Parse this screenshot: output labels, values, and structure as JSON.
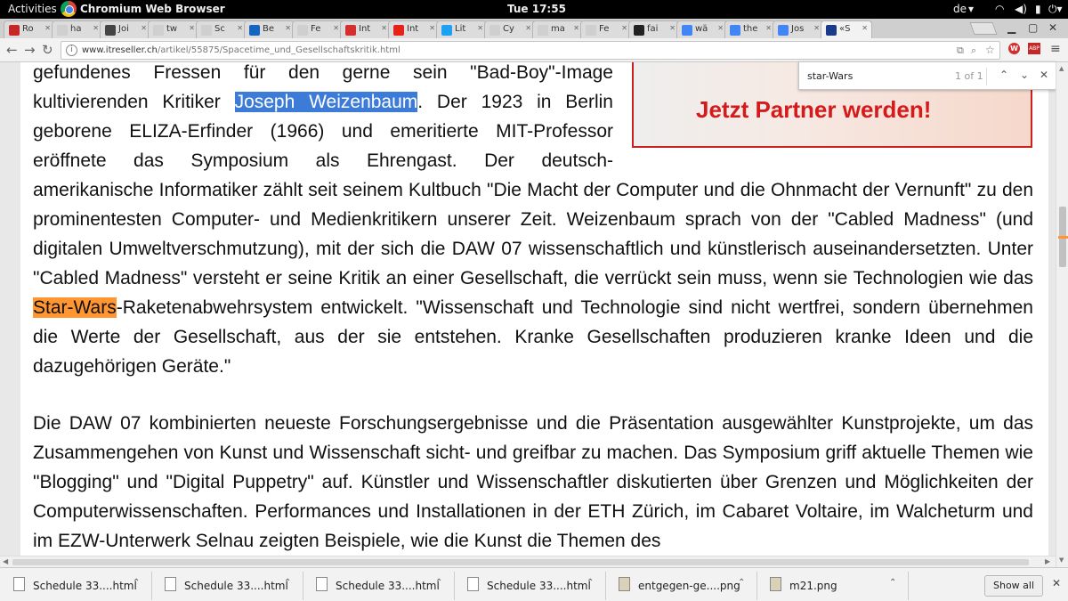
{
  "topbar": {
    "activities": "Activities",
    "app_name": "Chromium Web Browser",
    "clock": "Tue 17:55",
    "keyboard_layout": "de"
  },
  "tabs": [
    {
      "label": "Ro",
      "favicon_color": "#c62828"
    },
    {
      "label": "ha",
      "favicon_color": "#cfcfcf"
    },
    {
      "label": "Joi",
      "favicon_color": "#444444"
    },
    {
      "label": "tw",
      "favicon_color": "#cfcfcf"
    },
    {
      "label": "Sc",
      "favicon_color": "#cfcfcf"
    },
    {
      "label": "Be",
      "favicon_color": "#1565c0"
    },
    {
      "label": "Fe",
      "favicon_color": "#cfcfcf"
    },
    {
      "label": "Int",
      "favicon_color": "#d32f2f"
    },
    {
      "label": "Int",
      "favicon_color": "#e62117"
    },
    {
      "label": "Lit",
      "favicon_color": "#1da1f2"
    },
    {
      "label": "Cy",
      "favicon_color": "#cfcfcf"
    },
    {
      "label": "ma",
      "favicon_color": "#cfcfcf"
    },
    {
      "label": "Fe",
      "favicon_color": "#cfcfcf"
    },
    {
      "label": "fai",
      "favicon_color": "#222222"
    },
    {
      "label": "wä",
      "favicon_color": "#4285f4"
    },
    {
      "label": "the",
      "favicon_color": "#4285f4"
    },
    {
      "label": "Jos",
      "favicon_color": "#4285f4"
    },
    {
      "label": "«S",
      "favicon_color": "#1a3a8a"
    }
  ],
  "address_bar": {
    "host": "www.itreseller.ch",
    "path": "/artikel/55875/Spacetime_und_Gesellschaftskritik.html"
  },
  "find_bar": {
    "query": "star-Wars",
    "match_count": "1 of 1"
  },
  "ad": {
    "text": "Jetzt Partner werden!"
  },
  "article": {
    "p1_narrow": [
      {
        "text": "gefundenes Fressen für den gerne sein \"Bad-Boy\"-Image"
      },
      {
        "pre": "kultivierenden Kritiker ",
        "sel": "Joseph Weizenbaum",
        "post": ". Der 1923 in Berlin"
      },
      {
        "text": "geborene ELIZA-Erfinder (1966) und emeritierte MIT-Professor"
      },
      {
        "text": "eröffnete das Symposium als Ehrengast. Der deutsch-"
      }
    ],
    "p1_wide_pre": "amerikanische Informatiker zählt seit seinem Kultbuch \"Die Macht der Computer und die Ohnmacht der Vernunft\" zu den prominentesten Computer- und Medienkritikern unserer Zeit. Weizenbaum sprach von der \"Cabled Madness\" (und digitalen Umweltverschmutzung), mit der sich die DAW 07 wissenschaftlich und künstlerisch auseinandersetzten. Unter \"Cabled Madness\" versteht er seine Kritik an einer Gesellschaft, die verrückt sein muss, wenn sie Technologien wie das ",
    "p1_find_match": "Star-Wars",
    "p1_wide_post": "-Raketenabwehrsystem entwickelt. \"Wissenschaft und Technologie sind nicht wertfrei, sondern übernehmen die Werte der Gesellschaft, aus der sie entstehen. Kranke Gesellschaften produzieren kranke Ideen und die dazugehörigen Geräte.\"",
    "p2": "Die DAW 07 kombinierten neueste Forschungsergebnisse und die Präsentation ausgewählter Kunstprojekte, um das Zusammengehen von Kunst und Wissenschaft sicht- und greifbar zu machen. Das Symposium griff aktuelle Themen wie \"Blogging\" und \"Digital Puppetry\" auf. Künstler und Wissenschaftler diskutierten über Grenzen und Möglichkeiten der Computerwissenschaften. Performances und Installationen in der ETH Zürich, im Cabaret Voltaire, im Walcheturm und im EZW-Unterwerk Selnau zeigten Beispiele, wie die Kunst die Themen des"
  },
  "downloads": [
    {
      "name": "Schedule 33....html",
      "kind": "html"
    },
    {
      "name": "Schedule 33....html",
      "kind": "html"
    },
    {
      "name": "Schedule 33....html",
      "kind": "html"
    },
    {
      "name": "Schedule 33....html",
      "kind": "html"
    },
    {
      "name": "entgegen-ge....png",
      "kind": "png"
    },
    {
      "name": "m21.png",
      "kind": "png"
    }
  ],
  "show_all_label": "Show all"
}
